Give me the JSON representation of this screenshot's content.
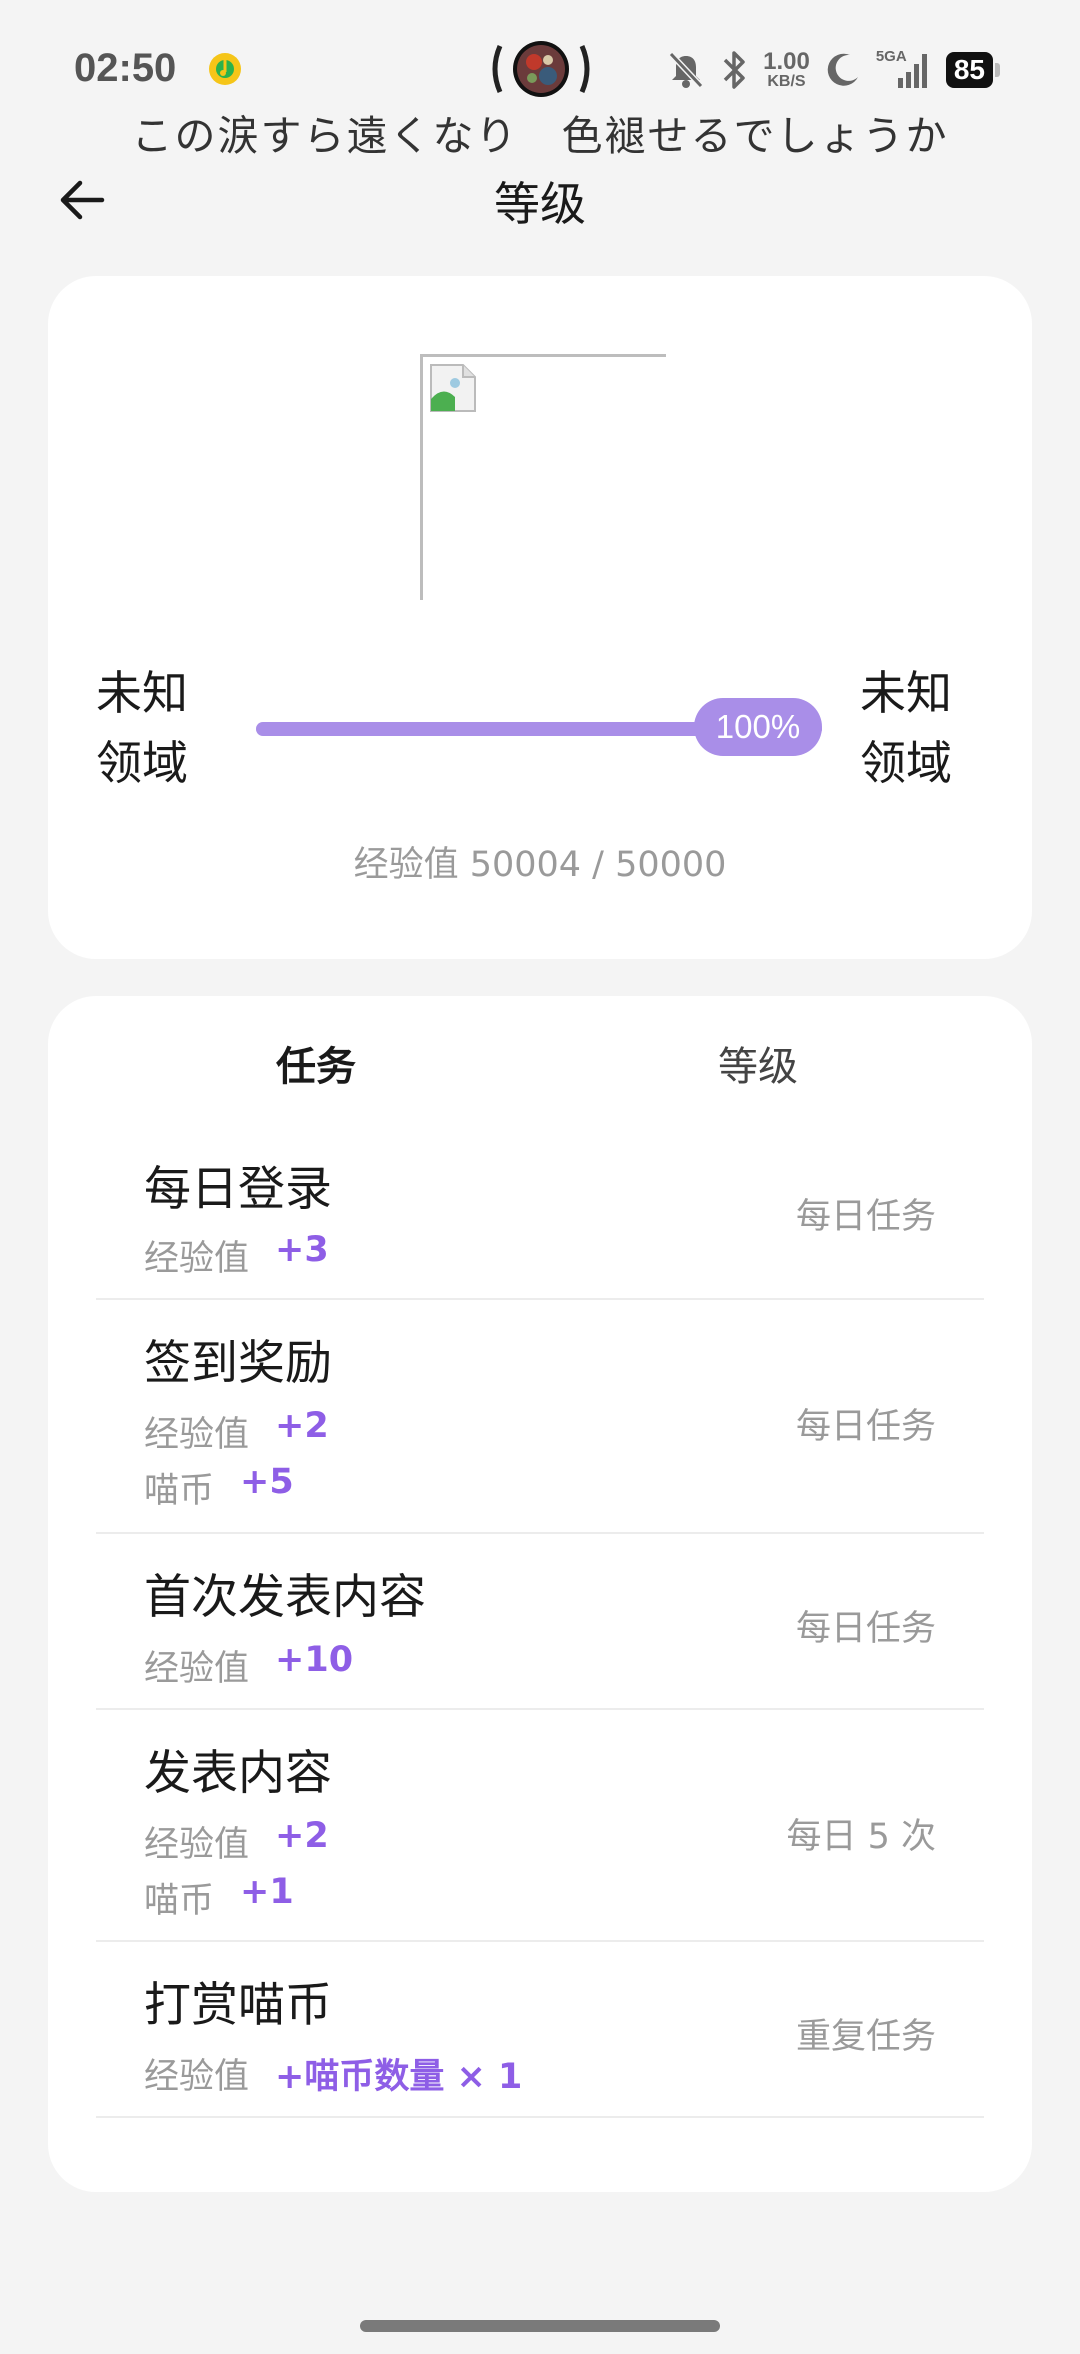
{
  "status_bar": {
    "time": "02:50",
    "net_speed_value": "1.00",
    "net_speed_unit": "KB/S",
    "signal_label": "5GA",
    "battery": "85",
    "icons": [
      "music-icon",
      "dynamic-island-avatar",
      "mute-icon",
      "bluetooth-icon",
      "moon-icon",
      "signal-icon",
      "battery-icon"
    ]
  },
  "lyric": "この涙すら遠くなり　色褪せるでしょうか",
  "header": {
    "title": "等级",
    "back_icon": "arrow-left-icon"
  },
  "level_card": {
    "current_level_line1": "未知",
    "current_level_line2": "领域",
    "next_level_line1": "未知",
    "next_level_line2": "领域",
    "progress_percent": 100,
    "progress_label": "100%",
    "exp_text": "经验值 50004 / 50000",
    "accent_color": "#a98ee8"
  },
  "tabs": [
    {
      "label": "任务",
      "active": true
    },
    {
      "label": "等级",
      "active": false
    }
  ],
  "tasks": [
    {
      "name": "每日登录",
      "rewards": [
        {
          "key": "经验值",
          "value": "+3"
        }
      ],
      "type": "每日任务"
    },
    {
      "name": "签到奖励",
      "rewards": [
        {
          "key": "经验值",
          "value": "+2"
        },
        {
          "key": "喵币",
          "value": "+5"
        }
      ],
      "type": "每日任务"
    },
    {
      "name": "首次发表内容",
      "rewards": [
        {
          "key": "经验值",
          "value": "+10"
        }
      ],
      "type": "每日任务"
    },
    {
      "name": "发表内容",
      "rewards": [
        {
          "key": "经验值",
          "value": "+2"
        },
        {
          "key": "喵币",
          "value": "+1"
        }
      ],
      "type": "每日 5 次"
    },
    {
      "name": "打赏喵币",
      "rewards": [
        {
          "key": "经验值",
          "value": "+喵币数量 × 1"
        }
      ],
      "type": "重复任务"
    }
  ],
  "reward_color": "#8e5ee6"
}
